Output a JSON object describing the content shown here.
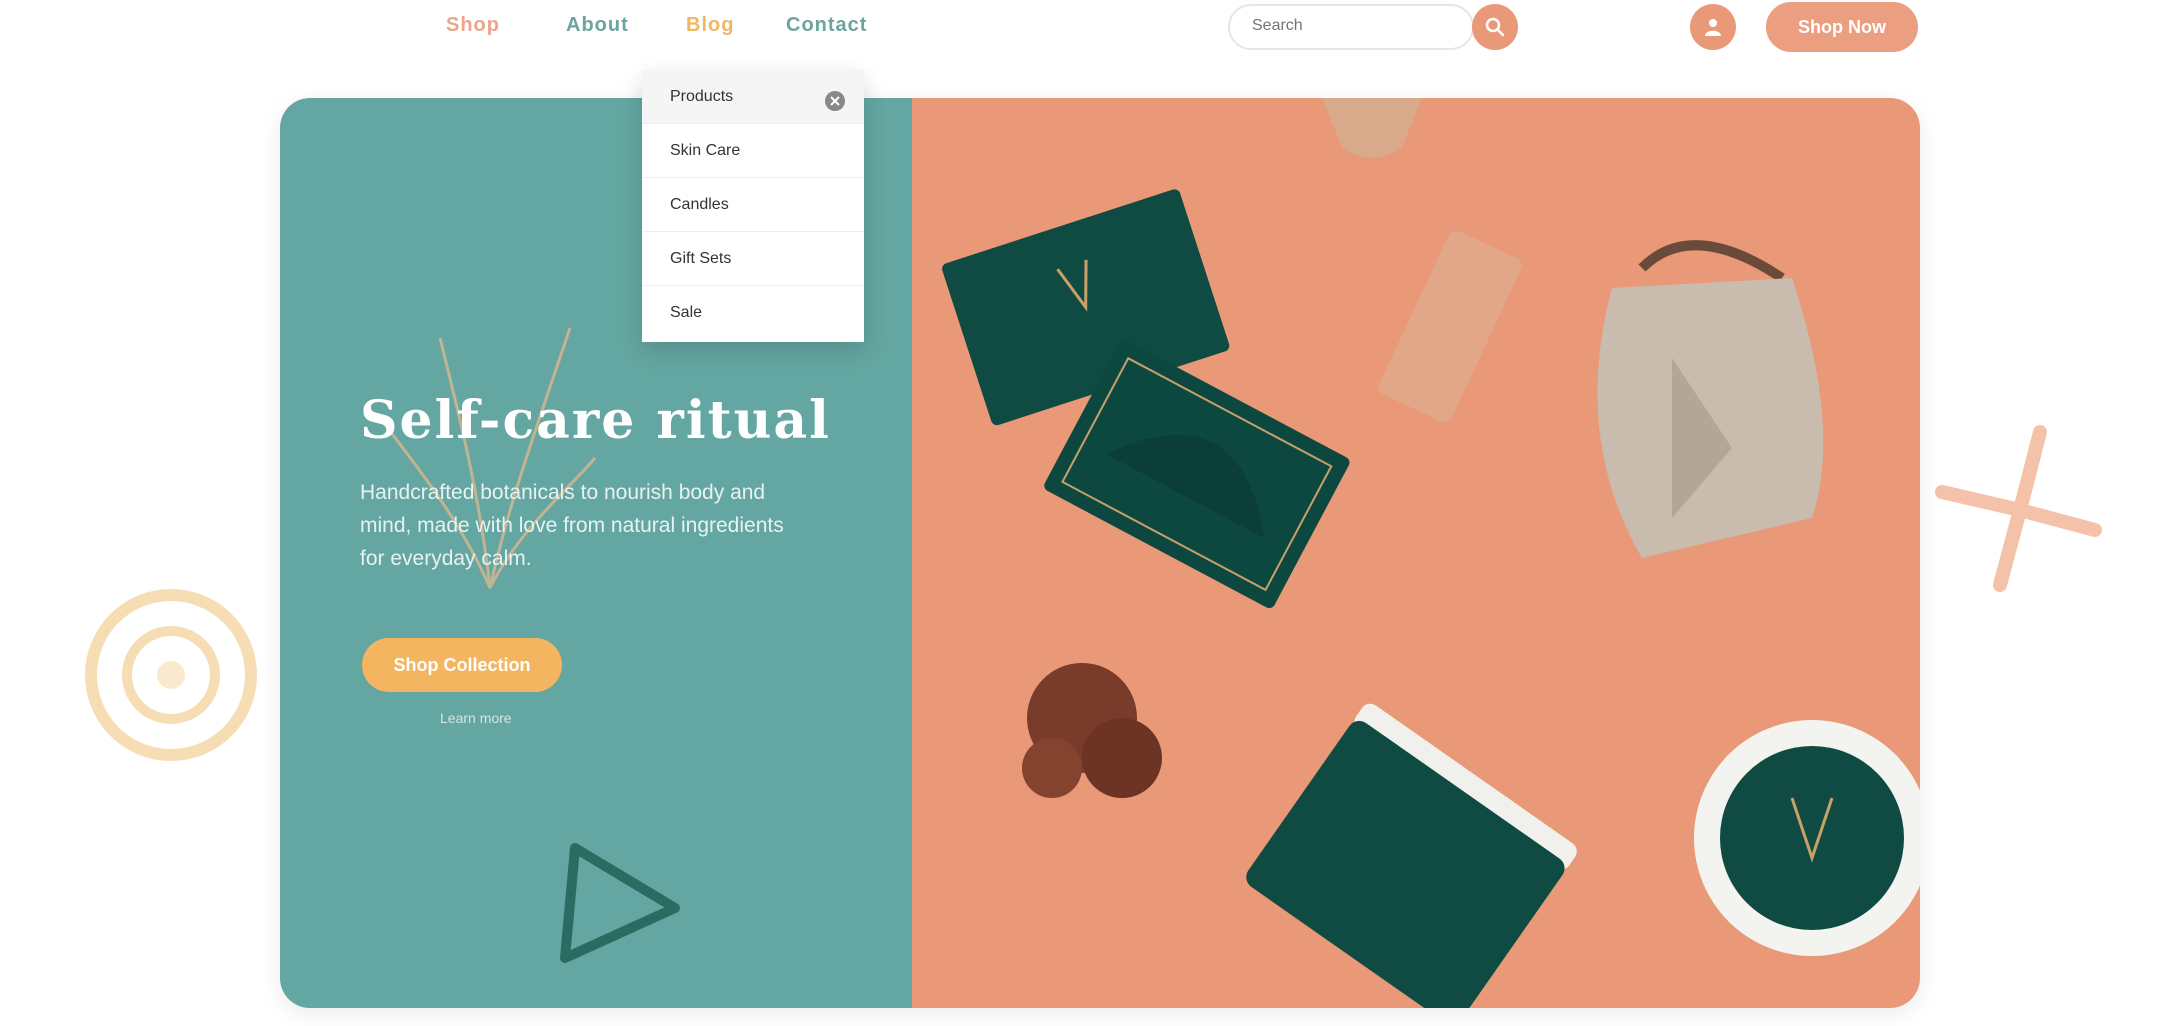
{
  "colors": {
    "teal": "#64a6a1",
    "coral": "#e99878",
    "dark_green": "#104a43",
    "gold": "#f4b560",
    "nav_teal": "#6ca4a0"
  },
  "nav": {
    "links": [
      "Shop",
      "About",
      "Blog",
      "Contact"
    ],
    "search_placeholder": "Search",
    "search_icon": "search-icon",
    "user_icon": "user-icon",
    "shop_button": "Shop Now"
  },
  "dropdown": {
    "items": [
      "Products",
      "Skin Care",
      "Candles",
      "Gift Sets",
      "Sale"
    ],
    "close_icon": "close-icon"
  },
  "hero": {
    "title": "Self-care ritual",
    "description": "Handcrafted botanicals to nourish body and mind, made with love from natural ingredients for everyday calm.",
    "cta": "Shop Collection",
    "cta_caption": "Learn more"
  }
}
